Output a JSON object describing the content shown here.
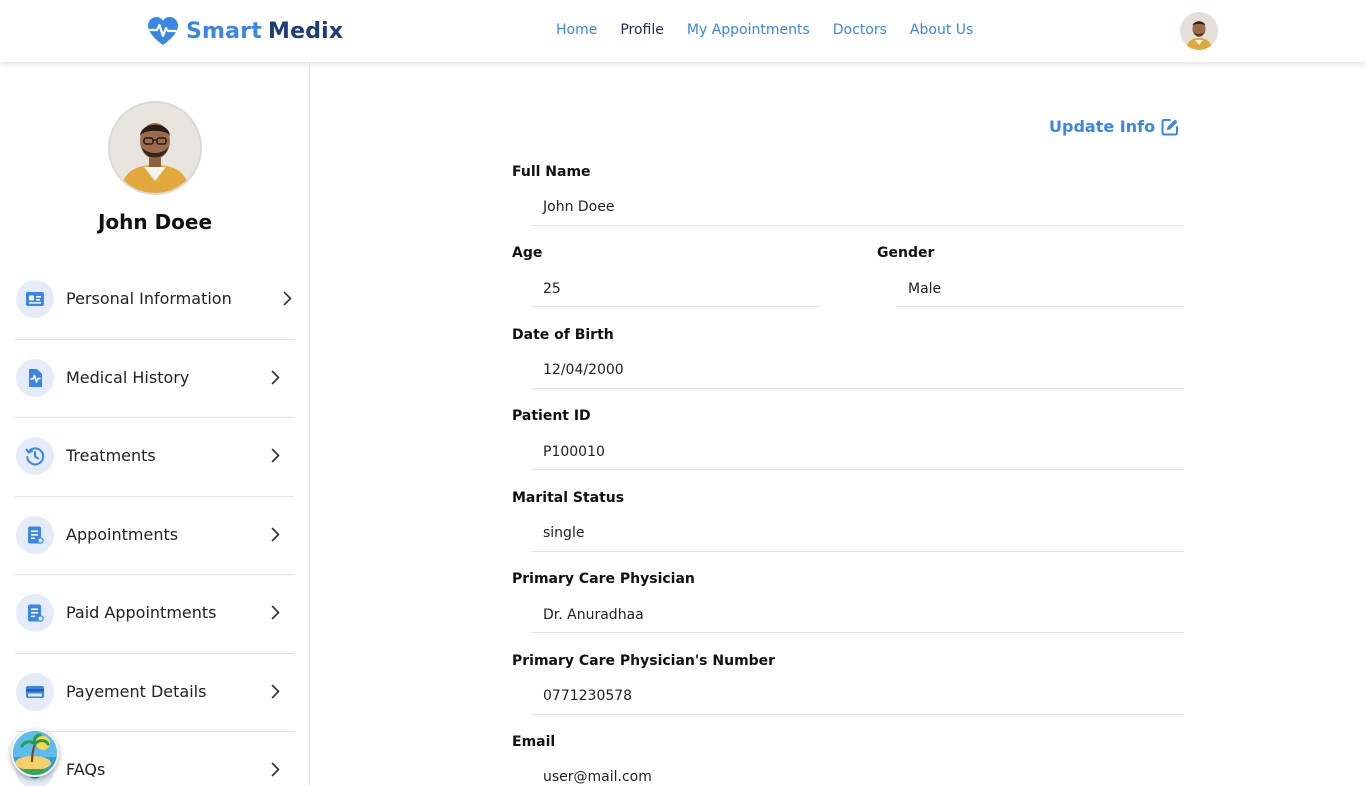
{
  "brand": {
    "name_part1": "Smart",
    "name_part2": "Medix",
    "accent": "#3a86e8",
    "dark": "#1f3d7a"
  },
  "nav": {
    "items": [
      "Home",
      "Profile",
      "My Appointments",
      "Doctors",
      "About Us"
    ],
    "active": "Profile"
  },
  "profile": {
    "name": "John Doee"
  },
  "sidebar": {
    "items": [
      {
        "label": "Personal Information",
        "icon": "id-card-icon"
      },
      {
        "label": "Medical History",
        "icon": "medical-report-icon"
      },
      {
        "label": "Treatments",
        "icon": "history-clock-icon"
      },
      {
        "label": "Appointments",
        "icon": "document-icon"
      },
      {
        "label": "Paid Appointments",
        "icon": "receipt-icon"
      },
      {
        "label": "Payement Details",
        "icon": "credit-card-icon"
      },
      {
        "label": "FAQs",
        "icon": "question-icon"
      }
    ]
  },
  "form": {
    "update_label": "Update Info",
    "full_name": {
      "label": "Full Name",
      "value": "John Doee"
    },
    "age": {
      "label": "Age",
      "value": "25"
    },
    "gender": {
      "label": "Gender",
      "value": "Male"
    },
    "dob": {
      "label": "Date of Birth",
      "value": "12/04/2000"
    },
    "patient_id": {
      "label": "Patient ID",
      "value": "P100010"
    },
    "marital_status": {
      "label": "Marital Status",
      "value": "single"
    },
    "physician": {
      "label": "Primary Care Physician",
      "value": "Dr. Anuradhaa"
    },
    "physician_number": {
      "label": "Primary Care Physician's Number",
      "value": "0771230578"
    },
    "email": {
      "label": "Email",
      "value": "user@mail.com"
    }
  }
}
